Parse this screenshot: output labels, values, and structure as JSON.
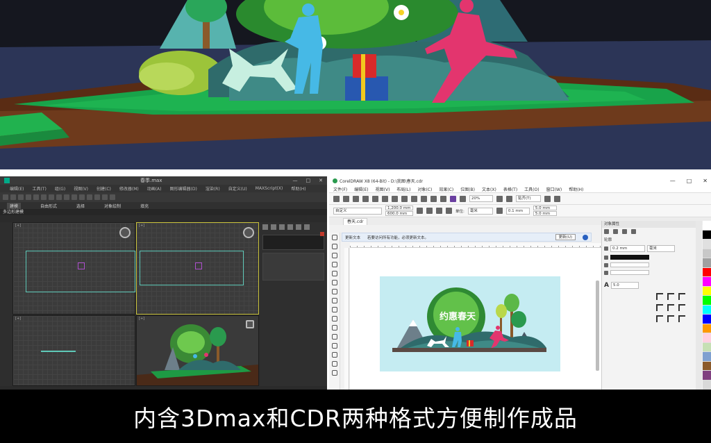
{
  "render": {
    "description_free": true
  },
  "max_window": {
    "title": "春季.max",
    "menus": [
      "编辑(E)",
      "工具(T)",
      "组(G)",
      "视图(V)",
      "创建(C)",
      "修改器(M)",
      "动画(A)",
      "图形编辑器(D)",
      "渲染(R)",
      "自定义(U)",
      "MAXScript(X)",
      "帮助(H)"
    ],
    "ribbon_tabs": [
      "建模",
      "自由形式",
      "选择",
      "对象绘制",
      "填充"
    ],
    "subtab": "多边形建模"
  },
  "cdr_window": {
    "title": "CorelDRAW X8 (64-Bit) - D:\\我图\\春天.cdr",
    "menus": [
      "文件(F)",
      "编辑(E)",
      "视图(V)",
      "布局(L)",
      "对象(C)",
      "效果(C)",
      "位图(B)",
      "文本(X)",
      "表格(T)",
      "工具(O)",
      "窗口(W)",
      "帮助(H)"
    ],
    "zoom": "20%",
    "snap": "贴齐(T)",
    "preset": "自定义",
    "width": "1,200.0 mm",
    "height": "600.0 mm",
    "units_label": "单位:",
    "units": "毫米",
    "nudge": "0.1 mm",
    "dup_x": "5.0 mm",
    "dup_y": "5.0 mm",
    "doc_tab": "春天.cdr",
    "infobar_text": "更新文本",
    "infobar_msg": "若要访问所有功能，必须更新文本。",
    "infobar_btn": "更新(U)",
    "docker_title": "对象属性",
    "docker_outline": "轮廓",
    "outline_width": "0.2 mm",
    "outline_units": "毫米",
    "miter": "5.0",
    "ruler_marks": [
      "400",
      "300",
      "200",
      "100",
      "0",
      "100",
      "200",
      "300",
      "400",
      "500",
      "600",
      "700",
      "800",
      "900"
    ],
    "palette_colors": [
      "#ffffff",
      "#000000",
      "#e0e0e0",
      "#c8c8c8",
      "#a0a0a0",
      "#ff0000",
      "#ff00ff",
      "#ffff00",
      "#00ff00",
      "#00ffff",
      "#0000ff",
      "#ff9900",
      "#ffd1e1",
      "#c6e0b4",
      "#7fa0d0",
      "#8b5a2b",
      "#804080",
      "#d9d9d9"
    ],
    "artwork_title": "约惠春天"
  },
  "caption": "内含3Dmax和CDR两种格式方便制作成品"
}
